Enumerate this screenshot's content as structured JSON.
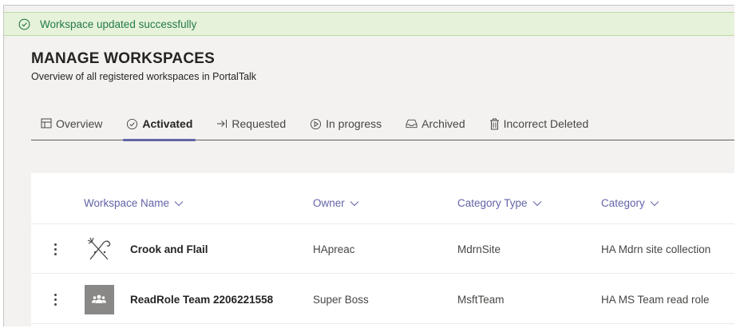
{
  "banner": {
    "message": "Workspace updated successfully"
  },
  "page": {
    "title": "MANAGE WORKSPACES",
    "subtitle": "Overview of all registered workspaces in PortalTalk"
  },
  "tabs": [
    {
      "label": "Overview",
      "icon": "overview-icon"
    },
    {
      "label": "Activated",
      "icon": "check-circle-icon",
      "active": true
    },
    {
      "label": "Requested",
      "icon": "arrow-right-bar-icon"
    },
    {
      "label": "In progress",
      "icon": "play-circle-icon"
    },
    {
      "label": "Archived",
      "icon": "inbox-icon"
    },
    {
      "label": "Incorrect Deleted",
      "icon": "trash-icon"
    }
  ],
  "table": {
    "columns": {
      "name": "Workspace Name",
      "owner": "Owner",
      "category_type": "Category Type",
      "category": "Category"
    },
    "rows": [
      {
        "icon": "crook-and-flail-icon",
        "name": "Crook and Flail",
        "owner": "HApreac",
        "category_type": "MdrnSite",
        "category": "HA Mdrn site collection"
      },
      {
        "icon": "team-icon",
        "name": "ReadRole Team 2206221558",
        "owner": "Super Boss",
        "category_type": "MsftTeam",
        "category": "HA MS Team read role"
      }
    ]
  },
  "colors": {
    "accent": "#6264a7",
    "success_bg": "#e7f2da",
    "success_text": "#237b4b",
    "background": "#f3f2f1"
  }
}
